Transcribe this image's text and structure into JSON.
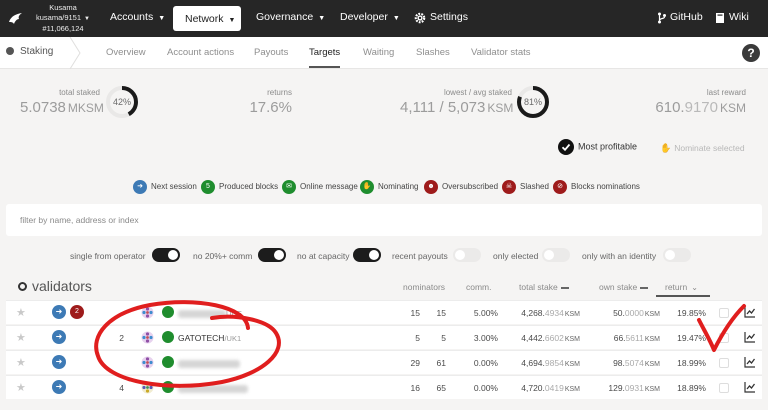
{
  "topbar": {
    "chain_name": "Kusama",
    "chain_version": "kusama/9151",
    "block": "#11,066,124",
    "menu": {
      "accounts": "Accounts",
      "network": "Network",
      "governance": "Governance",
      "developer": "Developer",
      "settings": "Settings"
    },
    "github": "GitHub",
    "wiki": "Wiki"
  },
  "subnav": {
    "section": "Staking",
    "tabs": [
      "Overview",
      "Account actions",
      "Payouts",
      "Targets",
      "Waiting",
      "Slashes",
      "Validator stats"
    ],
    "active_tab": "Targets"
  },
  "summary": {
    "total_staked_label": "total staked",
    "total_staked_value": "5.0738",
    "total_staked_unit": "MKSM",
    "total_staked_percent": "42%",
    "total_staked_fraction": 0.42,
    "returns_label": "returns",
    "returns_value": "17.6%",
    "lowest_avg_label": "lowest / avg staked",
    "lowest_avg_value": "4,111 / 5,073",
    "lowest_avg_unit": "KSM",
    "lowest_avg_percent": "81%",
    "lowest_avg_fraction": 0.81,
    "last_reward_label": "last reward",
    "last_reward_int": "610.",
    "last_reward_dec": "9170",
    "last_reward_unit": "KSM"
  },
  "actions": {
    "most_profitable": "Most profitable",
    "nominate_selected": "Nominate selected"
  },
  "legend": [
    {
      "label": "Next session",
      "color": "#3d7ab5"
    },
    {
      "label": "Produced blocks",
      "color": "#1f8d2e",
      "glyph": "5"
    },
    {
      "label": "Online message",
      "color": "#1f8d2e"
    },
    {
      "label": "Nominating",
      "color": "#1f8d2e"
    },
    {
      "label": "Oversubscribed",
      "color": "#9e1b1b"
    },
    {
      "label": "Slashed",
      "color": "#9e1b1b"
    },
    {
      "label": "Blocks nominations",
      "color": "#9e1b1b"
    }
  ],
  "filter": {
    "placeholder": "filter by name, address or index"
  },
  "toggles": [
    {
      "label": "single from operator",
      "on": true
    },
    {
      "label": "no 20%+ comm",
      "on": true
    },
    {
      "label": "no at capacity",
      "on": true
    },
    {
      "label": "recent payouts",
      "on": false
    },
    {
      "label": "only elected",
      "on": false
    },
    {
      "label": "only with an identity",
      "on": false
    }
  ],
  "table": {
    "title": "validators",
    "columns": {
      "nominators": "nominators",
      "comm": "comm.",
      "total_stake": "total stake",
      "own_stake": "own stake",
      "return": "return"
    },
    "rows": [
      {
        "rank": "",
        "name": "",
        "name_suffix": "UDE",
        "nom_a": "15",
        "nom_b": "15",
        "comm": "5.00%",
        "total_int": "4,268.",
        "total_dec": "4934",
        "own_int": "50.",
        "own_dec": "0000",
        "ret": "19.85%",
        "badge": "2"
      },
      {
        "rank": "2",
        "name": "GATOTECH",
        "name_suffix": "/UK1",
        "nom_a": "5",
        "nom_b": "5",
        "comm": "3.00%",
        "total_int": "4,442.",
        "total_dec": "6602",
        "own_int": "66.",
        "own_dec": "5611",
        "ret": "19.47%",
        "badge": ""
      },
      {
        "rank": "",
        "name": "",
        "name_suffix": "",
        "nom_a": "29",
        "nom_b": "61",
        "comm": "0.00%",
        "total_int": "4,694.",
        "total_dec": "9854",
        "own_int": "98.",
        "own_dec": "5074",
        "ret": "18.99%",
        "badge": ""
      },
      {
        "rank": "4",
        "name": "",
        "name_suffix": "",
        "nom_a": "16",
        "nom_b": "65",
        "comm": "0.00%",
        "total_int": "4,720.",
        "total_dec": "0419",
        "own_int": "129.",
        "own_dec": "0931",
        "ret": "18.89%",
        "badge": ""
      }
    ],
    "unit": "KSM"
  }
}
